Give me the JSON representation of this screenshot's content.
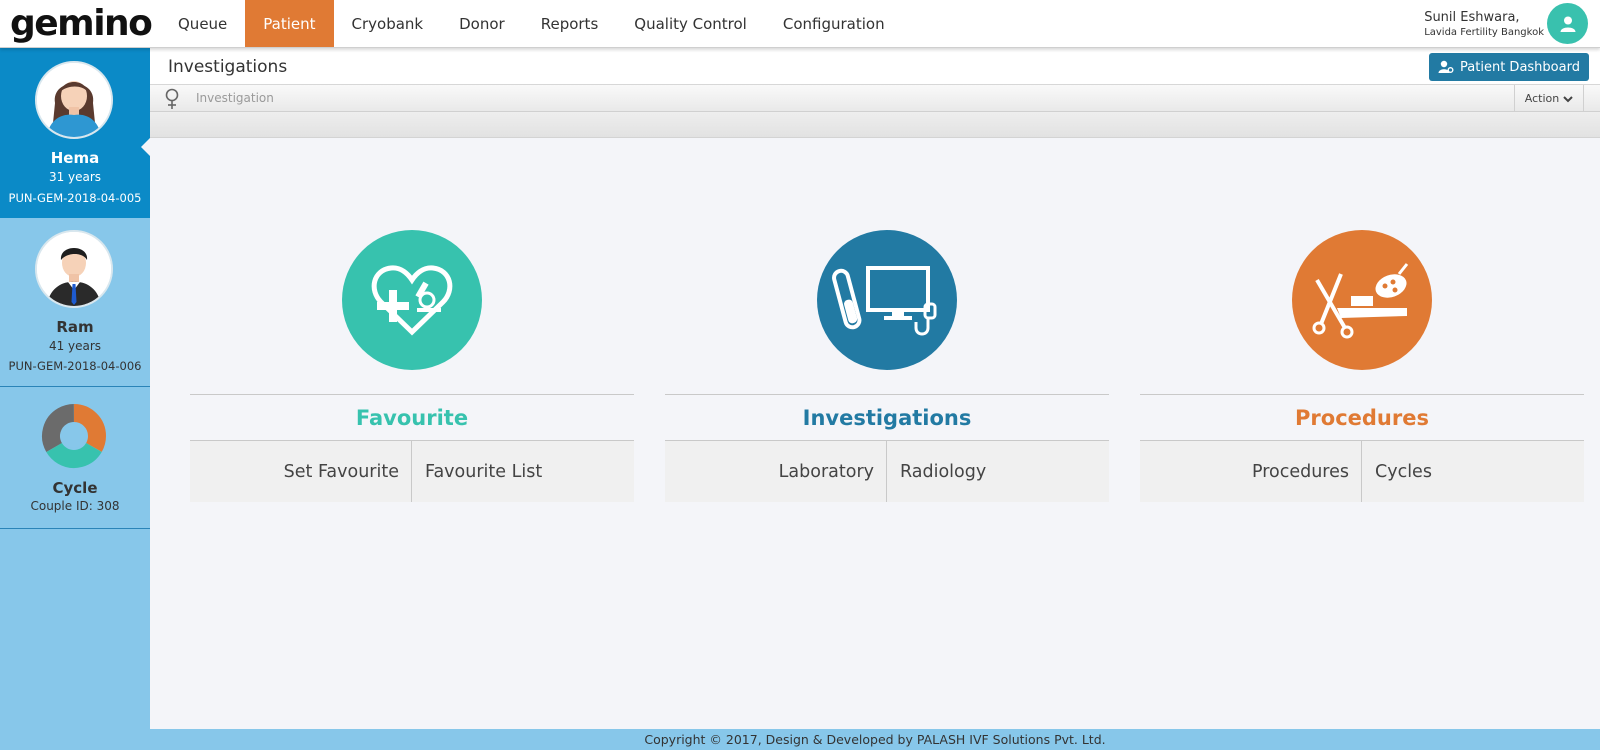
{
  "brand": {
    "logo_text": "gemino"
  },
  "nav": [
    {
      "label": "Queue"
    },
    {
      "label": "Patient",
      "active": true
    },
    {
      "label": "Cryobank"
    },
    {
      "label": "Donor"
    },
    {
      "label": "Reports"
    },
    {
      "label": "Quality Control"
    },
    {
      "label": "Configuration"
    }
  ],
  "user": {
    "name": "Sunil Eshwara,",
    "org": "Lavida Fertility Bangkok",
    "avatar_icon": "user-icon"
  },
  "sidebar": {
    "female": {
      "name": "Hema",
      "age": "31 years",
      "id": "PUN-GEM-2018-04-005"
    },
    "male": {
      "name": "Ram",
      "age": "41 years",
      "id": "PUN-GEM-2018-04-006"
    },
    "cycle": {
      "name": "Cycle",
      "couple_id": "Couple ID: 308"
    }
  },
  "header": {
    "title": "Investigations",
    "dashboard_button": "Patient Dashboard",
    "breadcrumb": "Investigation",
    "action": "Action"
  },
  "panels": [
    {
      "title": "Favourite",
      "color": "#37c2ae",
      "links": [
        "Set Favourite",
        "Favourite List"
      ]
    },
    {
      "title": "Investigations",
      "color": "#227aa3",
      "links": [
        "Laboratory",
        "Radiology"
      ]
    },
    {
      "title": "Procedures",
      "color": "#e07a34",
      "links": [
        "Procedures",
        "Cycles"
      ]
    }
  ],
  "footer": {
    "text": "Copyright © 2017, Design & Developed by PALASH IVF Solutions Pvt. Ltd."
  },
  "colors": {
    "accent_orange": "#e07a34",
    "teal": "#37c2ae",
    "blue": "#227aa3",
    "sidebar_blue": "#87c7ea",
    "sidebar_active": "#0b8ac7"
  }
}
